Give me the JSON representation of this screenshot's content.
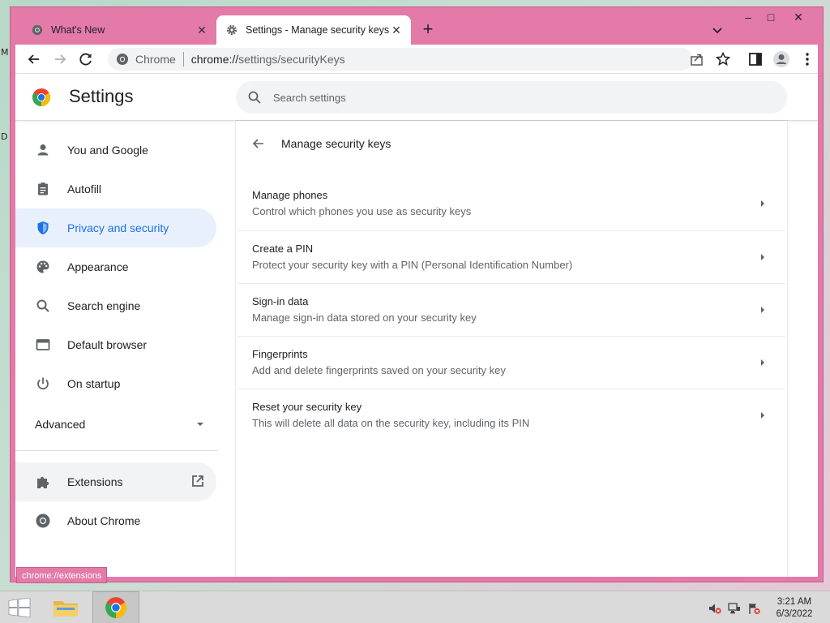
{
  "browser": {
    "tabs": [
      {
        "title": "What's New",
        "active": false
      },
      {
        "title": "Settings - Manage security keys",
        "active": true
      }
    ],
    "new_tab": "+",
    "window_controls": {
      "minimize": "–",
      "maximize": "□",
      "close": "✕"
    },
    "omnibox": {
      "chip": "Chrome",
      "url_scheme": "chrome://",
      "url_path": "settings/securityKeys"
    },
    "status_url": "chrome://extensions"
  },
  "settings": {
    "title": "Settings",
    "search_placeholder": "Search settings",
    "nav": [
      {
        "label": "You and Google",
        "icon": "person-icon"
      },
      {
        "label": "Autofill",
        "icon": "clipboard-icon"
      },
      {
        "label": "Privacy and security",
        "icon": "shield-icon",
        "selected": true
      },
      {
        "label": "Appearance",
        "icon": "palette-icon"
      },
      {
        "label": "Search engine",
        "icon": "search-icon"
      },
      {
        "label": "Default browser",
        "icon": "browser-icon"
      },
      {
        "label": "On startup",
        "icon": "power-icon"
      }
    ],
    "advanced_label": "Advanced",
    "extensions_label": "Extensions",
    "about_label": "About Chrome",
    "subpage": {
      "title": "Manage security keys",
      "rows": [
        {
          "title": "Manage phones",
          "subtitle": "Control which phones you use as security keys"
        },
        {
          "title": "Create a PIN",
          "subtitle": "Protect your security key with a PIN (Personal Identification Number)"
        },
        {
          "title": "Sign-in data",
          "subtitle": "Manage sign-in data stored on your security key"
        },
        {
          "title": "Fingerprints",
          "subtitle": "Add and delete fingerprints saved on your security key"
        },
        {
          "title": "Reset your security key",
          "subtitle": "This will delete all data on the security key, including its PIN"
        }
      ]
    }
  },
  "taskbar": {
    "time": "3:21 AM",
    "date": "6/3/2022"
  },
  "colors": {
    "window_frame": "#e37aa8",
    "accent": "#1a73e8",
    "selected_bg": "#e8f0fe"
  }
}
